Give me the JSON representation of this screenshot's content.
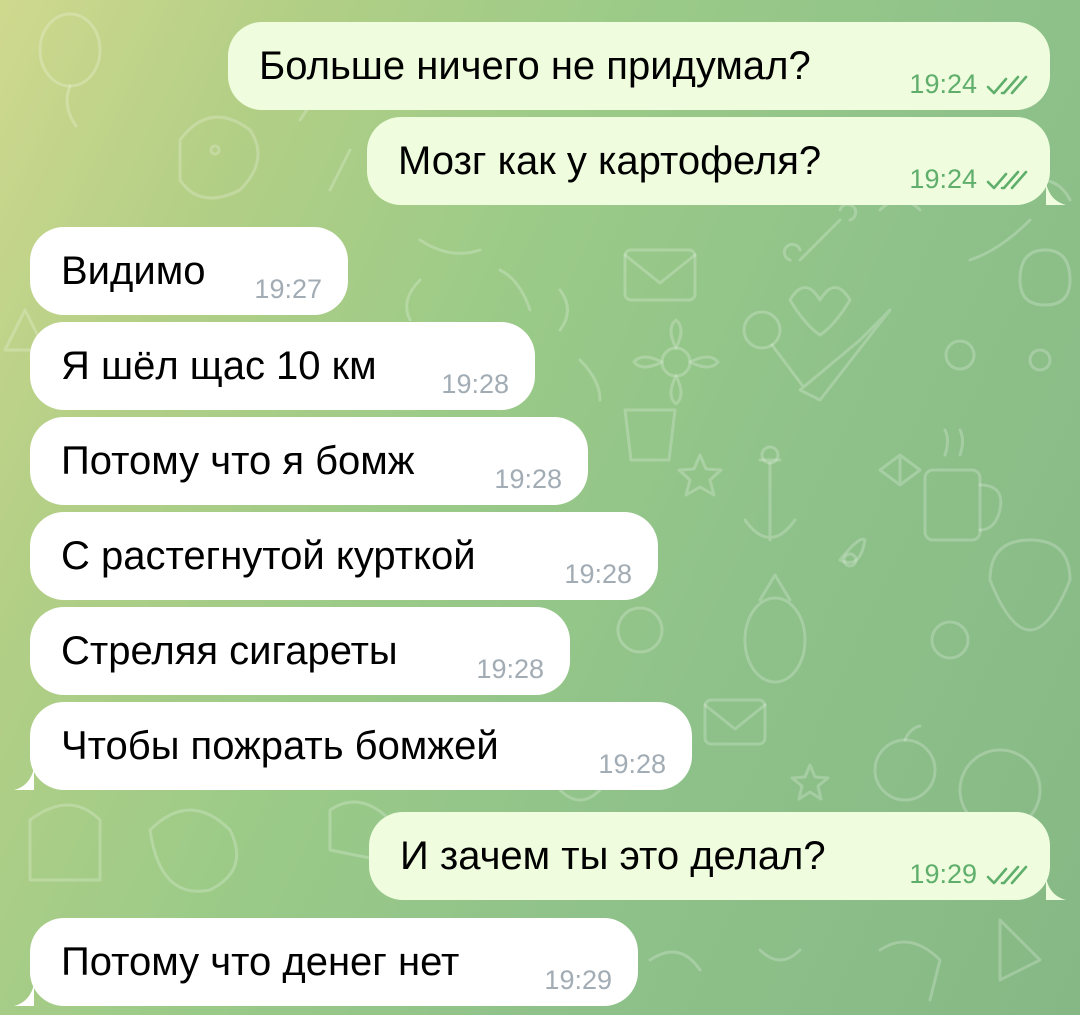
{
  "chat": {
    "background_colors": [
      "#cfd98e",
      "#9ccb88",
      "#86b885"
    ],
    "outgoing_bubble_color": "#effdde",
    "incoming_bubble_color": "#ffffff",
    "outgoing_time_color": "#5fae6c",
    "incoming_time_color": "#a2acb4",
    "messages": [
      {
        "direction": "out",
        "text": "Больше ничего не придумал?",
        "time": "19:24",
        "status_icon": "double-check-icon"
      },
      {
        "direction": "out",
        "text": "Мозг как у картофеля?",
        "time": "19:24",
        "status_icon": "double-check-icon"
      },
      {
        "direction": "in",
        "text": "Видимо",
        "time": "19:27"
      },
      {
        "direction": "in",
        "text": "Я шёл щас 10 км",
        "time": "19:28"
      },
      {
        "direction": "in",
        "text": "Потому что я бомж",
        "time": "19:28"
      },
      {
        "direction": "in",
        "text": "С растегнутой курткой",
        "time": "19:28"
      },
      {
        "direction": "in",
        "text": "Стреляя сигареты",
        "time": "19:28"
      },
      {
        "direction": "in",
        "text": "Чтобы пожрать бомжей",
        "time": "19:28"
      },
      {
        "direction": "out",
        "text": "И зачем ты это делал?",
        "time": "19:29",
        "status_icon": "double-check-icon"
      },
      {
        "direction": "in",
        "text": "Потому что денег нет",
        "time": "19:29"
      }
    ]
  }
}
